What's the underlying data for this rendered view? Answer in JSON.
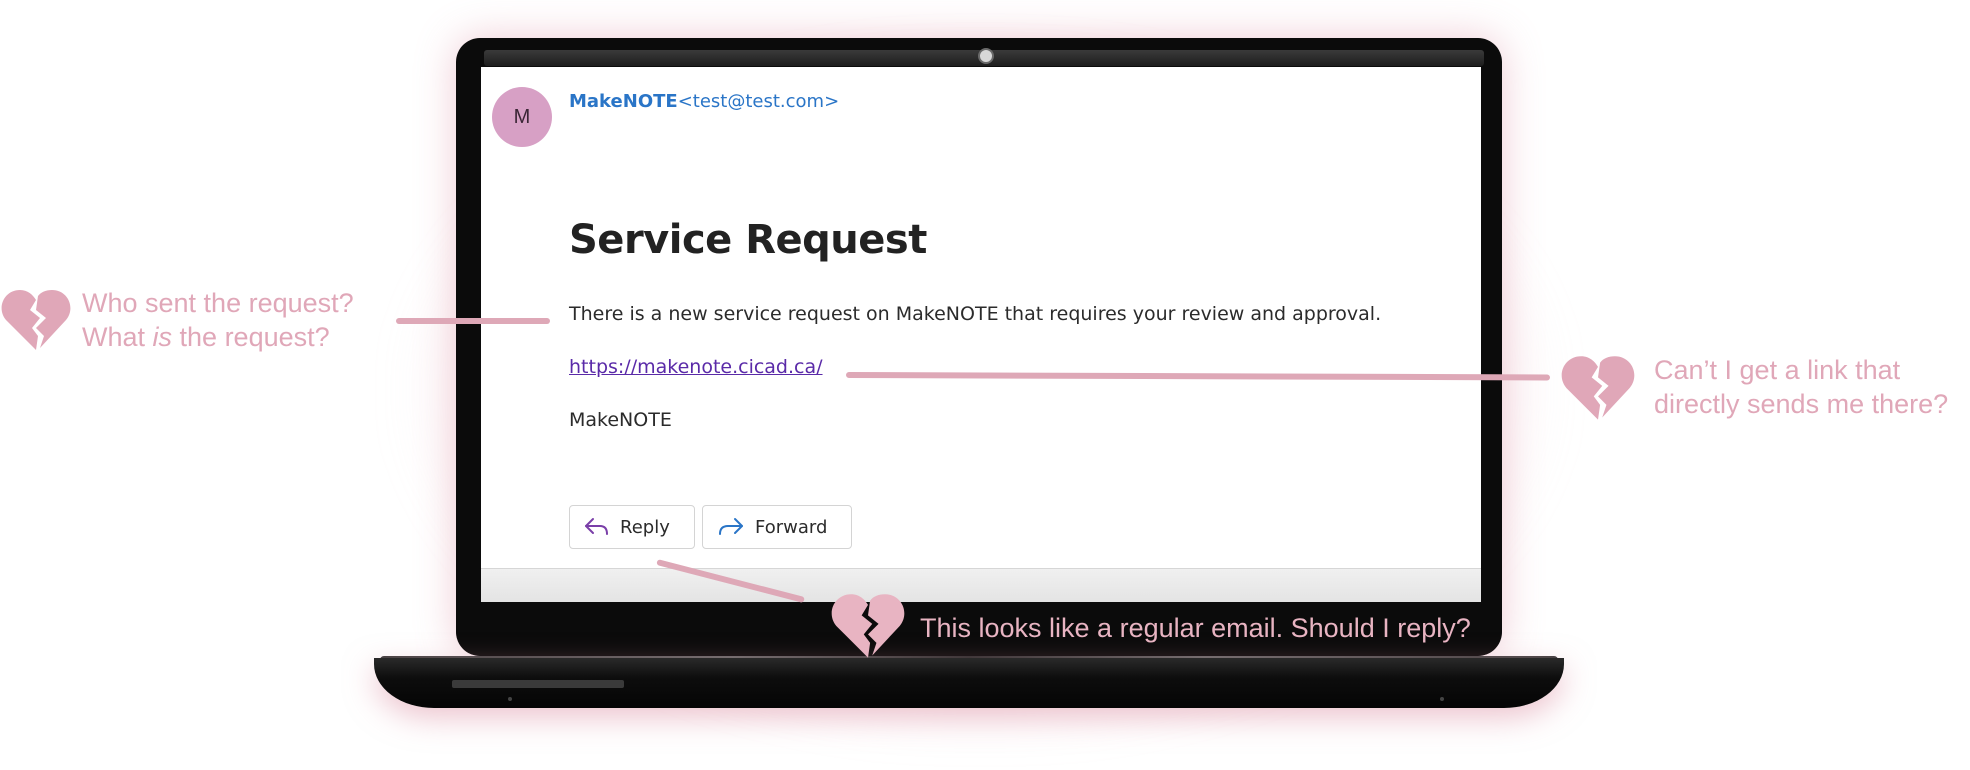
{
  "email": {
    "avatar_initial": "M",
    "sender_name": "MakeNOTE",
    "sender_email": "<test@test.com>",
    "subject": "Service Request",
    "body": "There is a new service request on MakeNOTE that requires your review and approval.",
    "link": "https://makenote.cicad.ca/",
    "signature": "MakeNOTE",
    "reply_label": "Reply",
    "forward_label": "Forward"
  },
  "annotations": {
    "left_line1": "Who sent the request?",
    "left_line2_pre": "What ",
    "left_line2_em": "is",
    "left_line2_post": " the request?",
    "right_line1": "Can’t I get a link that",
    "right_line2": "directly sends me there?",
    "bottom": "This looks like a regular email. Should I reply?"
  },
  "colors": {
    "annotation_pink": "#e0a7b8",
    "link_purple": "#5a2aa8",
    "sender_blue": "#2a75c7",
    "avatar_pink": "#d7a0c5"
  },
  "icons": [
    "broken-heart-icon",
    "reply-arrow-icon",
    "forward-arrow-icon"
  ]
}
